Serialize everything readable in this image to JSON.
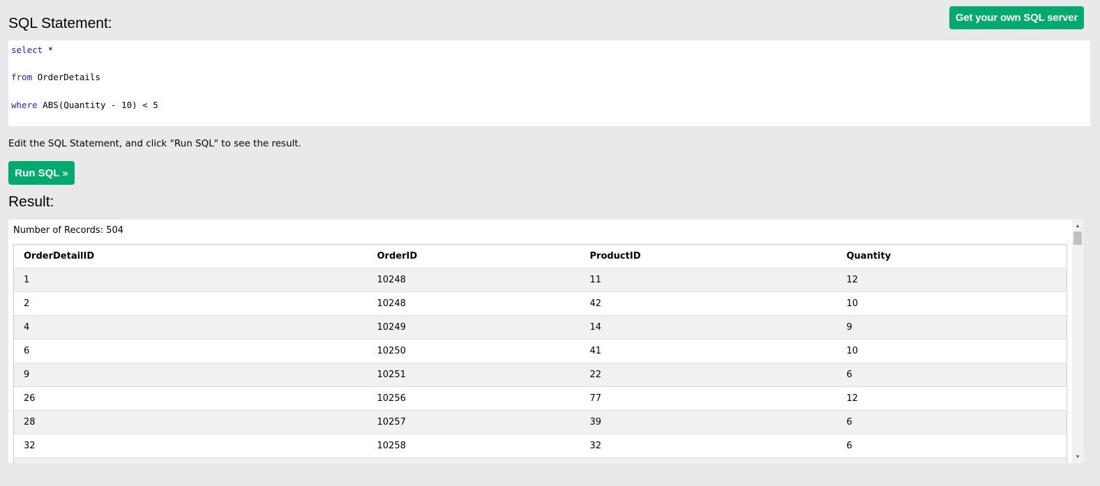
{
  "header": {
    "own_server_label": "Get your own SQL server",
    "sql_heading": "SQL Statement:"
  },
  "editor": {
    "line1": {
      "kw": "select",
      "rest": " *"
    },
    "line2": {
      "kw": "from",
      "rest": " OrderDetails"
    },
    "line3": {
      "kw": "where",
      "rest": " ABS(Quantity - 10) < 5"
    }
  },
  "hint_text": "Edit the SQL Statement, and click \"Run SQL\" to see the result.",
  "run_button_label": "Run SQL »",
  "result": {
    "heading": "Result:",
    "record_count": "Number of Records: 504",
    "columns": [
      "OrderDetailID",
      "OrderID",
      "ProductID",
      "Quantity"
    ],
    "rows": [
      [
        "1",
        "10248",
        "11",
        "12"
      ],
      [
        "2",
        "10248",
        "42",
        "10"
      ],
      [
        "4",
        "10249",
        "14",
        "9"
      ],
      [
        "6",
        "10250",
        "41",
        "10"
      ],
      [
        "9",
        "10251",
        "22",
        "6"
      ],
      [
        "26",
        "10256",
        "77",
        "12"
      ],
      [
        "28",
        "10257",
        "39",
        "6"
      ],
      [
        "32",
        "10258",
        "32",
        "6"
      ],
      [
        "",
        "",
        "",
        ""
      ]
    ]
  },
  "icons": {
    "scroll_up": "scroll-up-arrow-icon",
    "scroll_down": "scroll-down-arrow-icon"
  },
  "colors": {
    "accent": "#04aa6d",
    "keyword": "#2020cc",
    "background": "#e7e9eb"
  }
}
